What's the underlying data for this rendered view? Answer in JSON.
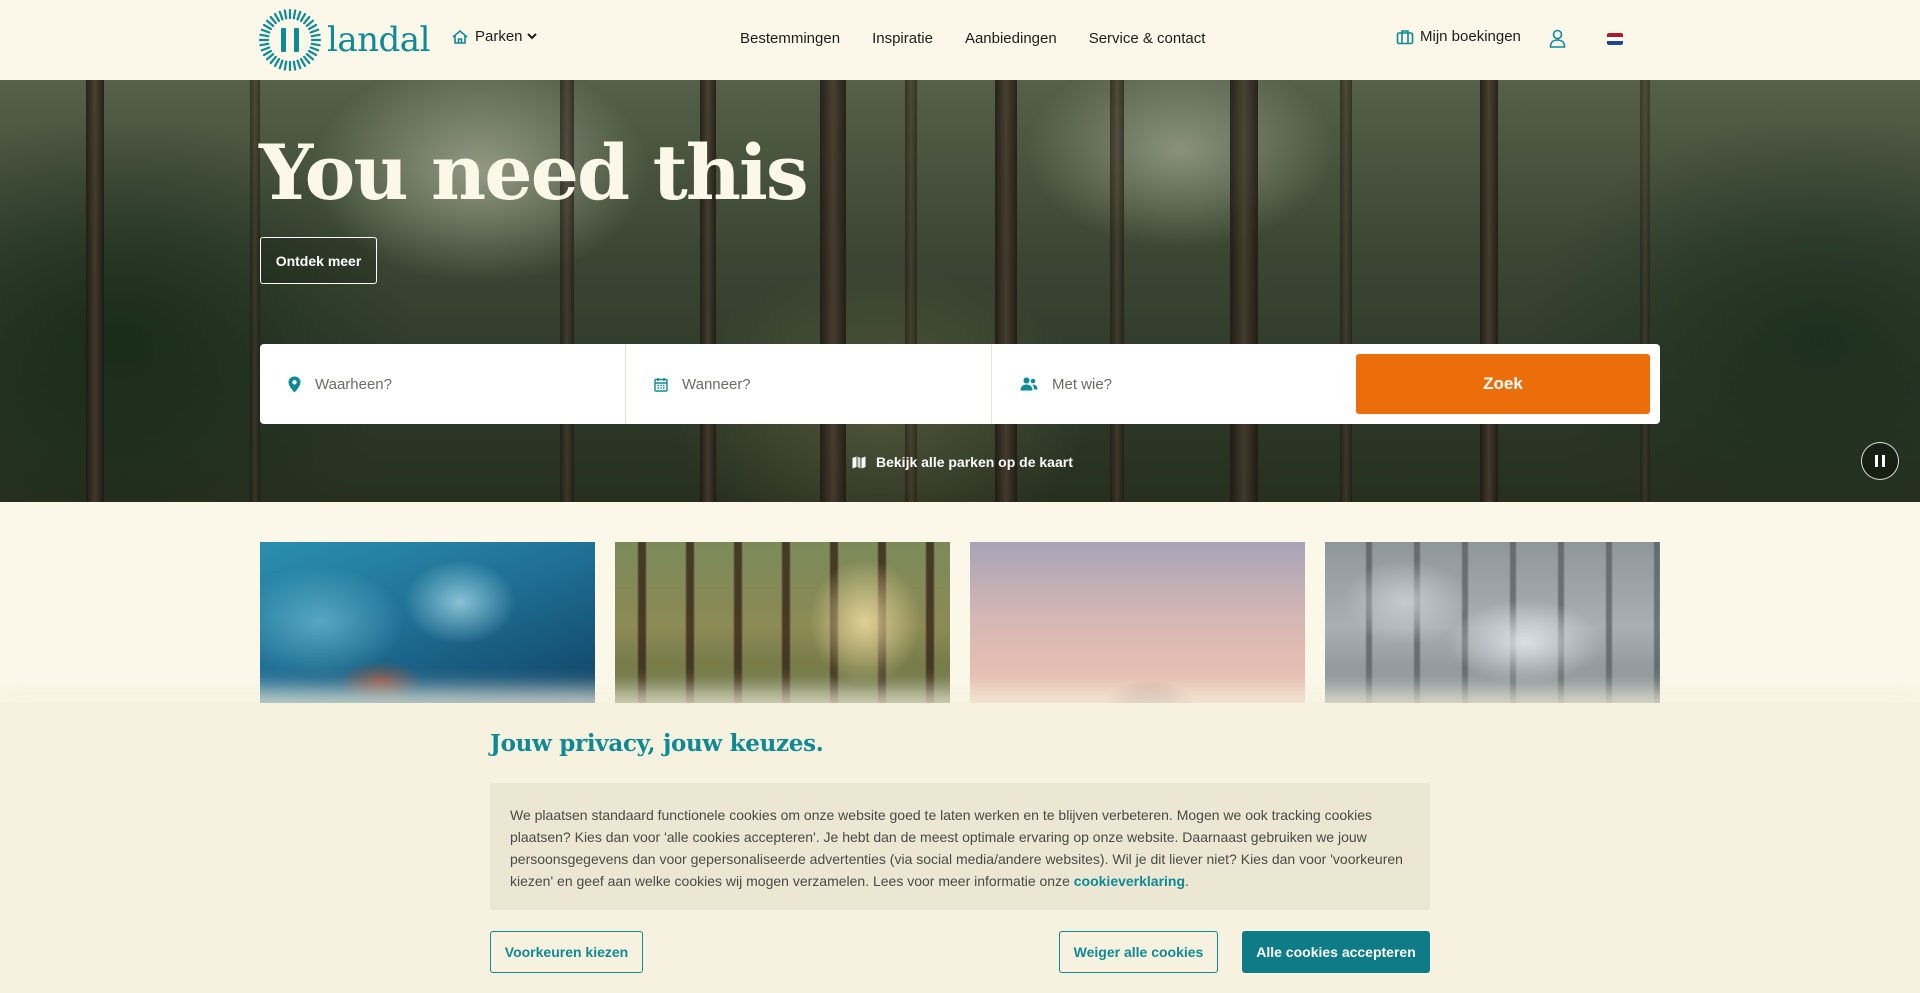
{
  "brand": {
    "name": "landal",
    "color": "#0f8a95"
  },
  "header": {
    "parks_label": "Parken",
    "nav": [
      "Bestemmingen",
      "Inspiratie",
      "Aanbiedingen",
      "Service & contact"
    ],
    "bookings_label": "Mijn boekingen",
    "language_flag": "nl-flag-icon"
  },
  "hero": {
    "title": "You need this",
    "cta_label": "Ontdek meer",
    "search": {
      "where_placeholder": "Waarheen?",
      "when_placeholder": "Wanneer?",
      "who_placeholder": "Met wie?",
      "submit_label": "Zoek",
      "submit_color": "#ec6e0a"
    },
    "map_link_label": "Bekijk alle parken op de kaart",
    "pause_icon": "pause-icon"
  },
  "cards": [
    {
      "image": "underwater-swimmer-photo"
    },
    {
      "image": "sunlit-forest-photo"
    },
    {
      "image": "sunset-couple-photo"
    },
    {
      "image": "snowy-tree-photo"
    }
  ],
  "cookie": {
    "title": "Jouw privacy, jouw keuzes.",
    "body": "We plaatsen standaard functionele cookies om onze website goed te laten werken en te blijven verbeteren. Mogen we ook tracking cookies plaatsen? Kies dan voor 'alle cookies accepteren'. Je hebt dan de meest optimale ervaring op onze website. Daarnaast gebruiken we jouw persoonsgegevens dan voor gepersonaliseerde advertenties (via social media/andere websites). Wil je dit liever niet? Kies dan voor 'voorkeuren kiezen' en geef aan welke cookies wij mogen verzamelen. Lees voor meer informatie onze ",
    "link_label": "cookieverklaring",
    "body_end": ".",
    "prefs_label": "Voorkeuren kiezen",
    "reject_label": "Weiger alle cookies",
    "accept_label": "Alle cookies accepteren"
  }
}
